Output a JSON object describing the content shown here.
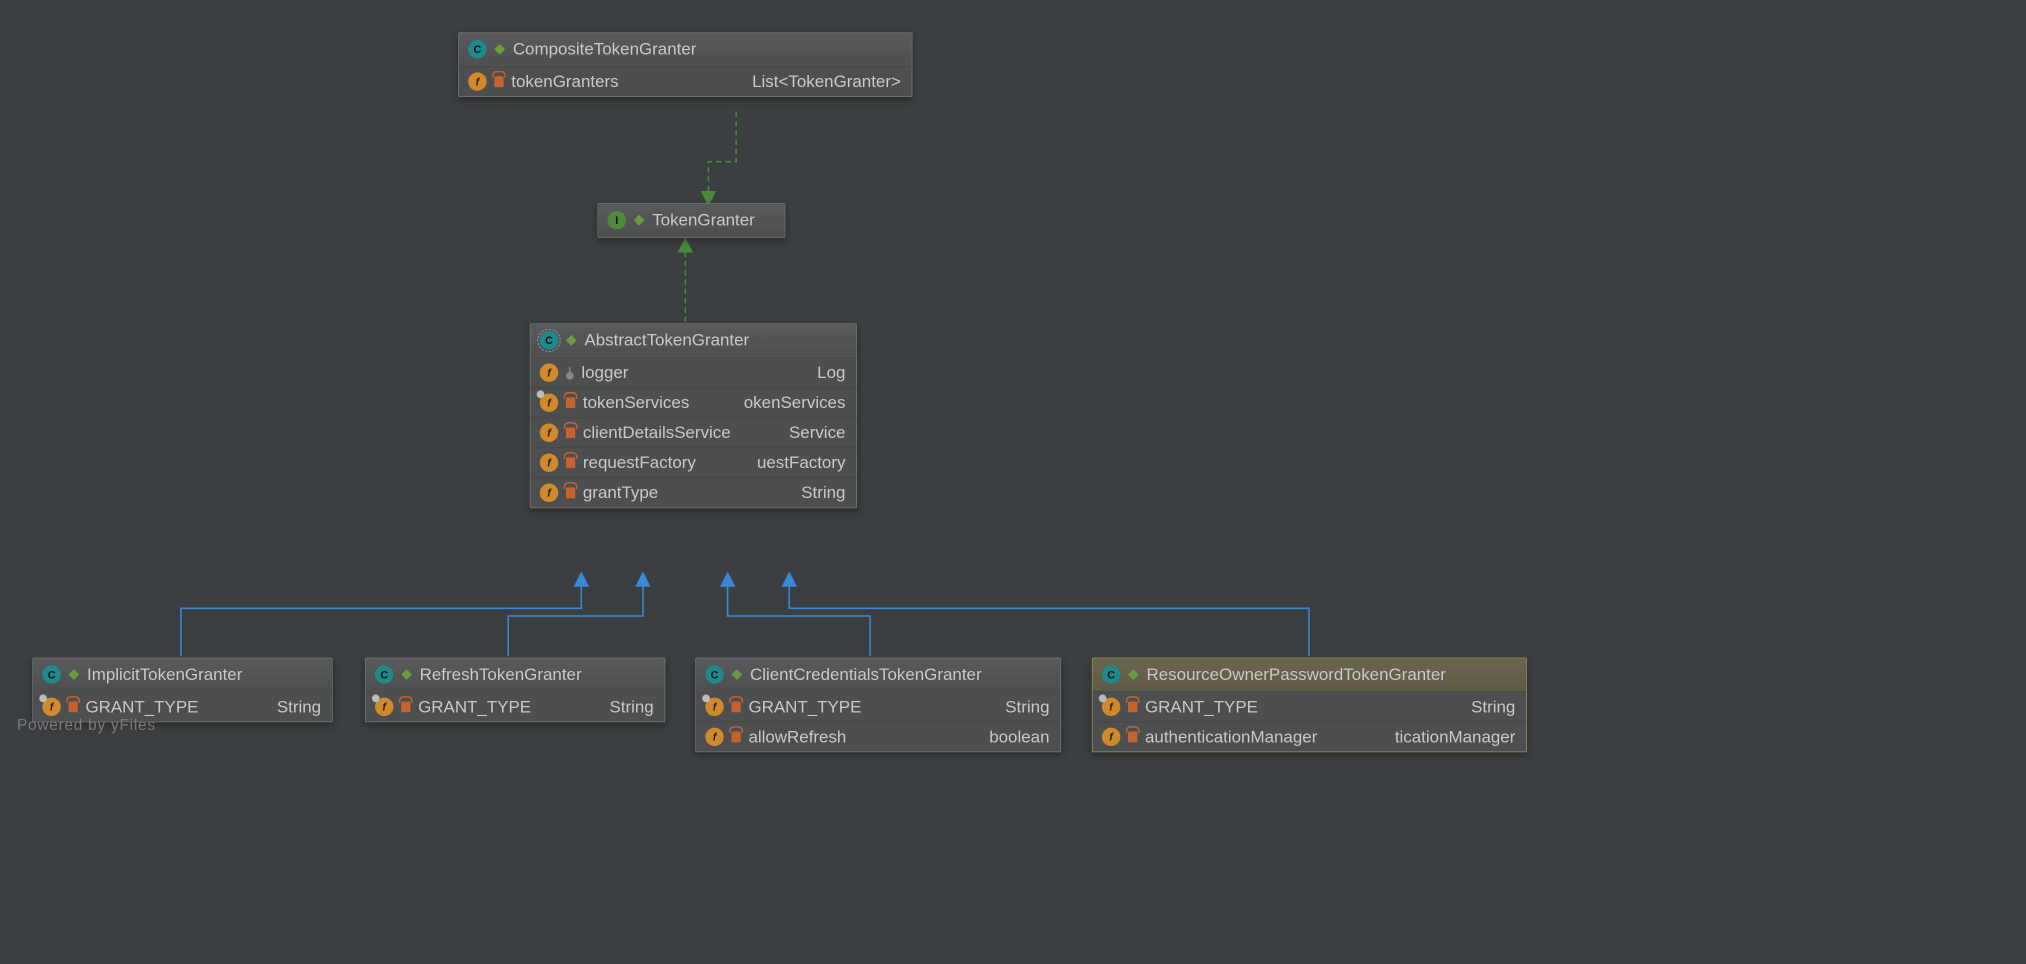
{
  "footer": "Powered by yFiles",
  "nodes": {
    "composite": {
      "title": "CompositeTokenGranter",
      "fields": [
        {
          "name": "tokenGranters",
          "type": "List<TokenGranter>",
          "access": "priv",
          "icon": "fld"
        }
      ]
    },
    "tokenGranter": {
      "title": "TokenGranter"
    },
    "abstract": {
      "title": "AbstractTokenGranter",
      "fields": [
        {
          "name": "logger",
          "type": "Log",
          "access": "prot",
          "icon": "fld"
        },
        {
          "name": "tokenServices",
          "type": "okenServices",
          "access": "priv",
          "icon": "fld inh"
        },
        {
          "name": "clientDetailsService",
          "type": "Service",
          "access": "priv",
          "icon": "fld"
        },
        {
          "name": "requestFactory",
          "type": "uestFactory",
          "access": "priv",
          "icon": "fld"
        },
        {
          "name": "grantType",
          "type": "String",
          "access": "priv",
          "icon": "fld"
        }
      ]
    },
    "implicit": {
      "title": "ImplicitTokenGranter",
      "fields": [
        {
          "name": "GRANT_TYPE",
          "type": "String",
          "access": "priv",
          "icon": "fld inh"
        }
      ]
    },
    "refresh": {
      "title": "RefreshTokenGranter",
      "fields": [
        {
          "name": "GRANT_TYPE",
          "type": "String",
          "access": "priv",
          "icon": "fld inh"
        }
      ]
    },
    "clientcred": {
      "title": "ClientCredentialsTokenGranter",
      "fields": [
        {
          "name": "GRANT_TYPE",
          "type": "String",
          "access": "priv",
          "icon": "fld inh"
        },
        {
          "name": "allowRefresh",
          "type": "boolean",
          "access": "priv",
          "icon": "fld"
        }
      ]
    },
    "resowner": {
      "title": "ResourceOwnerPasswordTokenGranter",
      "fields": [
        {
          "name": "GRANT_TYPE",
          "type": "String",
          "access": "priv",
          "icon": "fld inh"
        },
        {
          "name": "authenticationManager",
          "type": "ticationManager",
          "access": "priv",
          "icon": "fld"
        }
      ]
    }
  }
}
